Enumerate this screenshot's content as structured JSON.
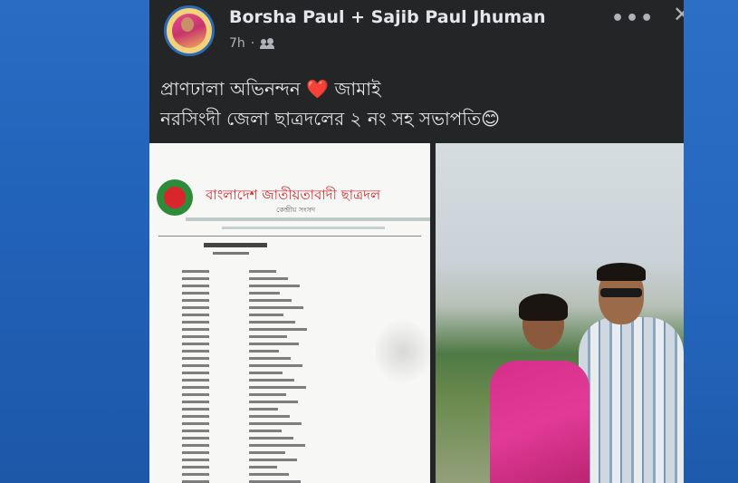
{
  "post": {
    "author": "Borsha Paul + Sajib Paul Jhuman",
    "time": "7h",
    "time_sep": "·",
    "audience_icon": "friends-icon",
    "more_label": "•••",
    "close_label": "✕",
    "line1_a": "প্রাণঢালা অভিনন্দন",
    "line1_heart": "❤️",
    "line1_b": "জামাই",
    "line2": "নরসিংদী জেলা ছাত্রদলের ২ নং সহ সভাপতি",
    "line2_emoji": "😊"
  },
  "document": {
    "org_title": "বাংলাদেশ জাতীয়তাবাদী ছাত্রদল",
    "org_sub": "কেন্দ্রীয় সংসদ"
  },
  "colors": {
    "card_bg": "#242526",
    "text_primary": "#e4e6eb",
    "text_secondary": "#b0b3b8",
    "page_bg": "#1f5fb3",
    "heart": "#e41e3f"
  }
}
